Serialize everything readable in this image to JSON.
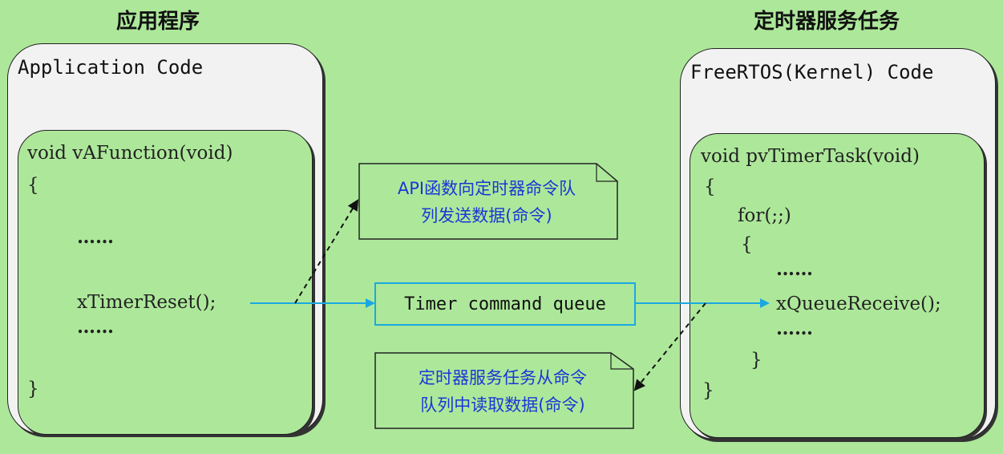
{
  "headings": {
    "left": "应用程序",
    "right": "定时器服务任务"
  },
  "left_box": {
    "title": "Application Code",
    "function_sig": "void vAFunction(void)",
    "open_brace": "{",
    "dots_1": "……",
    "call": "xTimerReset();",
    "dots_2": "……",
    "close_brace": "}"
  },
  "right_box": {
    "title": "FreeRTOS(Kernel) Code",
    "function_sig": "void pvTimerTask(void)",
    "open_brace": "{",
    "for_line": "for(;;)",
    "inner_open_brace": "{",
    "dots_1": "……",
    "call": "xQueueReceive();",
    "dots_2": "……",
    "inner_close_brace": "}",
    "close_brace": "}"
  },
  "queue": {
    "label": "Timer command queue"
  },
  "note_send": {
    "line1": "API函数向定时器命令队",
    "line2": "列发送数据(命令)"
  },
  "note_read": {
    "line1": "定时器服务任务从命令",
    "line2": "队列中读取数据(命令)"
  },
  "colors": {
    "background": "#ade89a",
    "panel": "#f2f2f2",
    "queue_arrow": "#19a9e0",
    "note_text": "#1a37d6"
  }
}
